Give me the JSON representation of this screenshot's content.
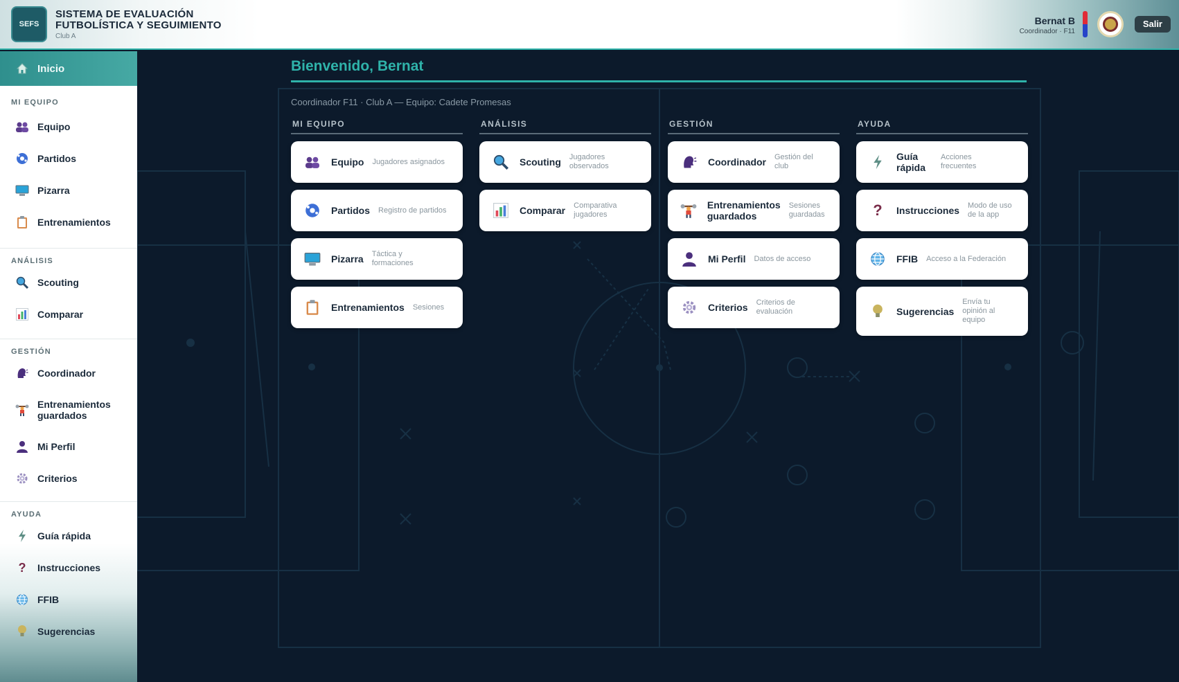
{
  "header": {
    "logo_text": "SEFS",
    "title": "SISTEMA DE EVALUACIÓN FUTBOLÍSTICA Y SEGUIMIENTO",
    "club": "Club A",
    "user_name": "Bernat B",
    "user_role": "Coordinador · F11",
    "logout_label": "Salir"
  },
  "sidebar": {
    "home_label": "Inicio",
    "sections": {
      "mi_equipo": "MI EQUIPO",
      "analisis": "ANÁLISIS",
      "gestion": "GESTIÓN",
      "ayuda": "AYUDA"
    },
    "items": {
      "equipo": "Equipo",
      "partidos": "Partidos",
      "pizarra": "Pizarra",
      "entrenamientos": "Entrenamientos",
      "scouting": "Scouting",
      "comparar": "Comparar",
      "coordinador": "Coordinador",
      "entrenamientos_guardados": "Entrenamientos guardados",
      "mi_perfil": "Mi Perfil",
      "criterios": "Criterios",
      "guia_rapida": "Guía rápida",
      "instrucciones": "Instrucciones",
      "ffib": "FFIB",
      "sugerencias": "Sugerencias"
    }
  },
  "main": {
    "welcome": "Bienvenido, Bernat",
    "subtitle": "Coordinador F11 · Club A — Equipo: Cadete Promesas",
    "columns": {
      "mi_equipo": {
        "title": "MI EQUIPO",
        "cards": [
          {
            "title": "Equipo",
            "desc": "Jugadores asignados"
          },
          {
            "title": "Partidos",
            "desc": "Registro de partidos"
          },
          {
            "title": "Pizarra",
            "desc": "Táctica y formaciones"
          },
          {
            "title": "Entrenamientos",
            "desc": "Sesiones"
          }
        ]
      },
      "analisis": {
        "title": "ANÁLISIS",
        "cards": [
          {
            "title": "Scouting",
            "desc": "Jugadores observados"
          },
          {
            "title": "Comparar",
            "desc": "Comparativa jugadores"
          }
        ]
      },
      "gestion": {
        "title": "GESTIÓN",
        "cards": [
          {
            "title": "Coordinador",
            "desc": "Gestión del club"
          },
          {
            "title": "Entrenamientos guardados",
            "desc": "Sesiones guardadas"
          },
          {
            "title": "Mi Perfil",
            "desc": "Datos de acceso"
          },
          {
            "title": "Criterios",
            "desc": "Criterios de evaluación"
          }
        ]
      },
      "ayuda": {
        "title": "AYUDA",
        "cards": [
          {
            "title": "Guía rápida",
            "desc": "Acciones frecuentes"
          },
          {
            "title": "Instrucciones",
            "desc": "Modo de uso de la app"
          },
          {
            "title": "FFIB",
            "desc": "Acceso a la Federación"
          },
          {
            "title": "Sugerencias",
            "desc": "Envía tu opinión al equipo"
          }
        ]
      }
    }
  },
  "icons": {
    "home": "house-icon",
    "equipo": "people-icon",
    "partidos": "soccer-ball-icon",
    "pizarra": "monitor-icon",
    "entrenamientos": "clipboard-icon",
    "scouting": "magnifier-icon",
    "comparar": "bar-chart-icon",
    "coordinador": "speaking-head-icon",
    "entrenamientos_guardados": "weightlifter-icon",
    "mi_perfil": "person-silhouette-icon",
    "criterios": "gear-icon",
    "guia_rapida": "lightning-icon",
    "instrucciones": "question-mark-icon",
    "ffib": "globe-icon",
    "sugerencias": "lightbulb-icon"
  },
  "colors": {
    "accent": "#2fb3aa",
    "background": "#0c1a2b",
    "card": "#ffffff"
  }
}
